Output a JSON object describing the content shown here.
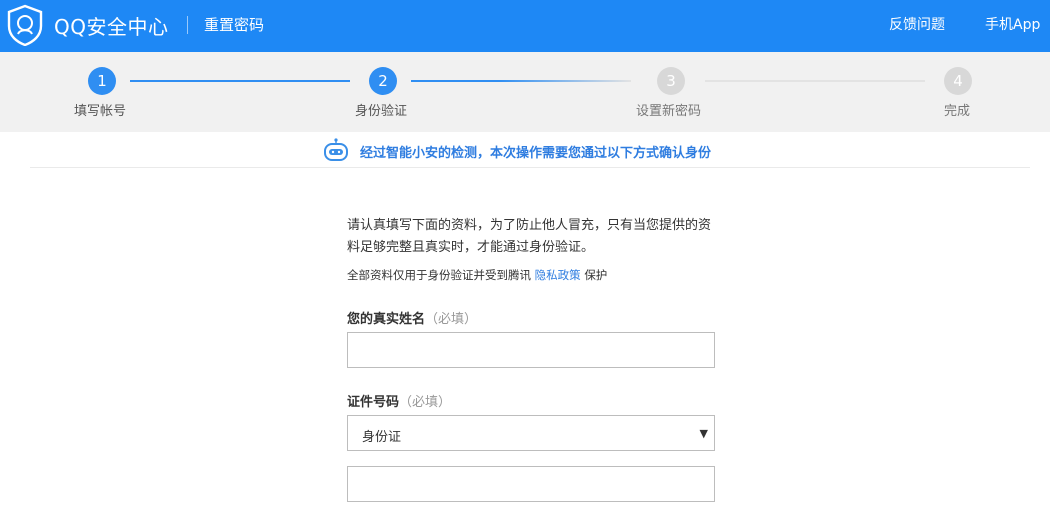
{
  "header": {
    "brand": "QQ安全中心",
    "subtitle": "重置密码",
    "nav": {
      "feedback": "反馈问题",
      "app": "手机App"
    },
    "bg_color": "#1e88f5"
  },
  "steps": [
    {
      "num": "1",
      "label": "填写帐号",
      "state": "active"
    },
    {
      "num": "2",
      "label": "身份验证",
      "state": "active"
    },
    {
      "num": "3",
      "label": "设置新密码",
      "state": "inactive"
    },
    {
      "num": "4",
      "label": "完成",
      "state": "inactive"
    }
  ],
  "notice": {
    "text": "经过智能小安的检测，本次操作需要您通过以下方式确认身份",
    "icon": "robot-icon"
  },
  "form": {
    "intro": "请认真填写下面的资料，为了防止他人冒充，只有当您提供的资料足够完整且真实时，才能通过身份验证。",
    "privacy_prefix": "全部资料仅用于身份验证并受到腾讯",
    "privacy_link": "隐私政策",
    "privacy_suffix": "保护",
    "name_label": "您的真实姓名",
    "name_required": "（必填）",
    "name_value": "",
    "id_label": "证件号码",
    "id_required": "（必填）",
    "id_type_selected": "身份证",
    "id_value": ""
  },
  "colors": {
    "accent": "#2f8ef2",
    "link": "#2f7de0",
    "inactive": "#d8d8d8"
  }
}
